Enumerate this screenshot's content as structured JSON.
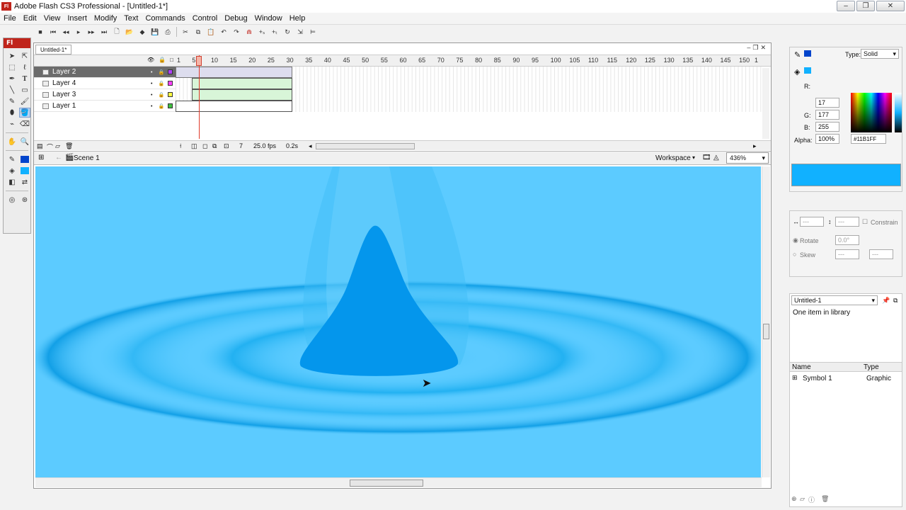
{
  "window": {
    "title": "Adobe Flash CS3 Professional - [Untitled-1*]",
    "app_icon": "Fl"
  },
  "menu": [
    "File",
    "Edit",
    "View",
    "Insert",
    "Modify",
    "Text",
    "Commands",
    "Control",
    "Debug",
    "Window",
    "Help"
  ],
  "tools_logo": "Fl",
  "document": {
    "tab": "Untitled-1*"
  },
  "timeline": {
    "ruler": [
      "1",
      "5",
      "10",
      "15",
      "20",
      "25",
      "30",
      "35",
      "40",
      "45",
      "50",
      "55",
      "60",
      "65",
      "70",
      "75",
      "80",
      "85",
      "90",
      "95",
      "100",
      "105",
      "110",
      "115",
      "120",
      "125",
      "130",
      "135",
      "140",
      "145",
      "150",
      "1"
    ],
    "layers": [
      {
        "name": "Layer 2",
        "color": "#b040ff",
        "active": true
      },
      {
        "name": "Layer 4",
        "color": "#ff40ff",
        "active": false
      },
      {
        "name": "Layer 3",
        "color": "#ffff40",
        "active": false
      },
      {
        "name": "Layer 1",
        "color": "#40c040",
        "active": false
      }
    ],
    "current_frame": "7",
    "fps": "25.0 fps",
    "time": "0.2s"
  },
  "editbar": {
    "scene": "Scene 1",
    "workspace": "Workspace",
    "zoom": "436%"
  },
  "color_panel": {
    "type_label": "Type:",
    "type_value": "Solid",
    "r_label": "R:",
    "r": "17",
    "g_label": "G:",
    "g": "177",
    "b_label": "B:",
    "b": "255",
    "alpha_label": "Alpha:",
    "alpha": "100%",
    "hex": "#11B1FF",
    "swatch_color": "#11b1ff"
  },
  "transform_panel": {
    "constrain": "Constrain",
    "rotate": "Rotate",
    "rotate_value": "0.0°",
    "skew": "Skew",
    "dash": "---"
  },
  "library": {
    "doc": "Untitled-1",
    "count": "One item in library",
    "col_name": "Name",
    "col_type": "Type",
    "items": [
      {
        "name": "Symbol 1",
        "type": "Graphic"
      }
    ]
  },
  "colors": {
    "stage": "#5ccbff",
    "ripple": "#0aa6ec",
    "drop": "#0496ec"
  }
}
